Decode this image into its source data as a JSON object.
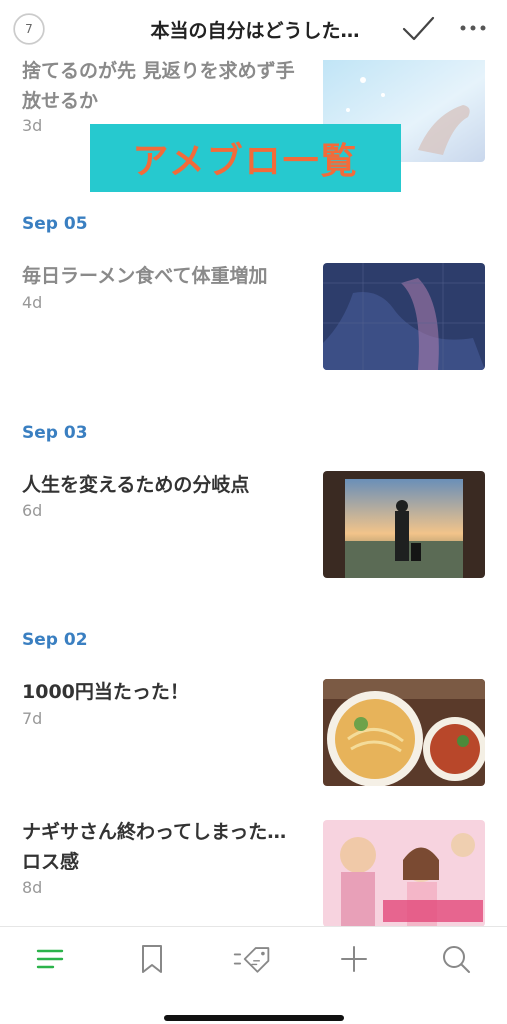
{
  "header": {
    "badge_count": "7",
    "title": "本当の自分はどうした…"
  },
  "overlay": {
    "text": "アメブロ一覧"
  },
  "feed": {
    "items": [
      {
        "title": "捨てるのが先 見返りを求めず手放せるか",
        "age": "3d"
      },
      {
        "date": "Sep 05",
        "title": "毎日ラーメン食べて体重増加",
        "age": "4d"
      },
      {
        "date": "Sep 03",
        "title": "人生を変えるための分岐点",
        "age": "6d"
      },
      {
        "date": "Sep 02",
        "title": "1000円当たった！",
        "age": "7d"
      },
      {
        "title": "ナギサさん終わってしまった…ロス感",
        "age": "8d"
      }
    ]
  },
  "colors": {
    "accent_green": "#2bb34a",
    "date_blue": "#3a7fc1",
    "overlay_bg": "#26c9cf",
    "overlay_text": "#f26b3a"
  },
  "tabbar": {
    "icons": [
      "list-icon",
      "bookmark-icon",
      "tag-icon",
      "plus-icon",
      "search-icon"
    ],
    "active": "list-icon"
  }
}
